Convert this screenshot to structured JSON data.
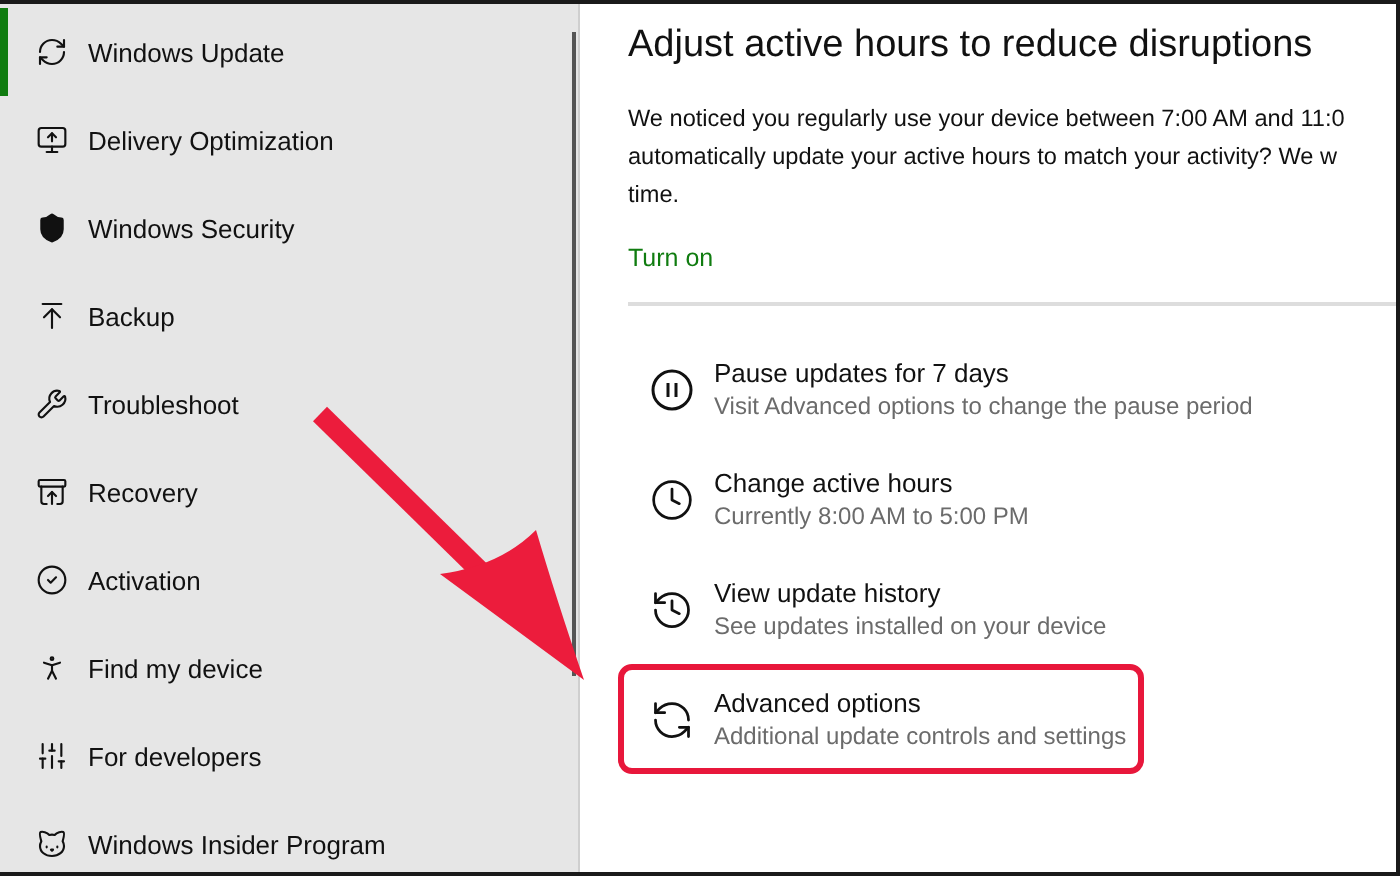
{
  "sidebar": {
    "items": [
      {
        "label": "Windows Update",
        "kind": "update",
        "selected": true
      },
      {
        "label": "Delivery Optimization",
        "kind": "delivery",
        "selected": false
      },
      {
        "label": "Windows Security",
        "kind": "security",
        "selected": false
      },
      {
        "label": "Backup",
        "kind": "backup",
        "selected": false
      },
      {
        "label": "Troubleshoot",
        "kind": "troubleshoot",
        "selected": false
      },
      {
        "label": "Recovery",
        "kind": "recovery",
        "selected": false
      },
      {
        "label": "Activation",
        "kind": "activation",
        "selected": false
      },
      {
        "label": "Find my device",
        "kind": "find",
        "selected": false
      },
      {
        "label": "For developers",
        "kind": "developers",
        "selected": false
      },
      {
        "label": "Windows Insider Program",
        "kind": "insider",
        "selected": false
      }
    ]
  },
  "active_hours": {
    "title": "Adjust active hours to reduce disruptions",
    "lines": [
      "We noticed you regularly use your device between 7:00 AM and 11:0",
      "automatically update your active hours to match your activity? We w",
      "time."
    ],
    "link": "Turn on"
  },
  "options": [
    {
      "title": "Pause updates for 7 days",
      "subtitle": "Visit Advanced options to change the pause period",
      "kind": "pause",
      "highlighted": false
    },
    {
      "title": "Change active hours",
      "subtitle": "Currently 8:00 AM to 5:00 PM",
      "kind": "hours",
      "highlighted": false
    },
    {
      "title": "View update history",
      "subtitle": "See updates installed on your device",
      "kind": "history",
      "highlighted": false
    },
    {
      "title": "Advanced options",
      "subtitle": "Additional update controls and settings",
      "kind": "advanced",
      "highlighted": true
    }
  ]
}
